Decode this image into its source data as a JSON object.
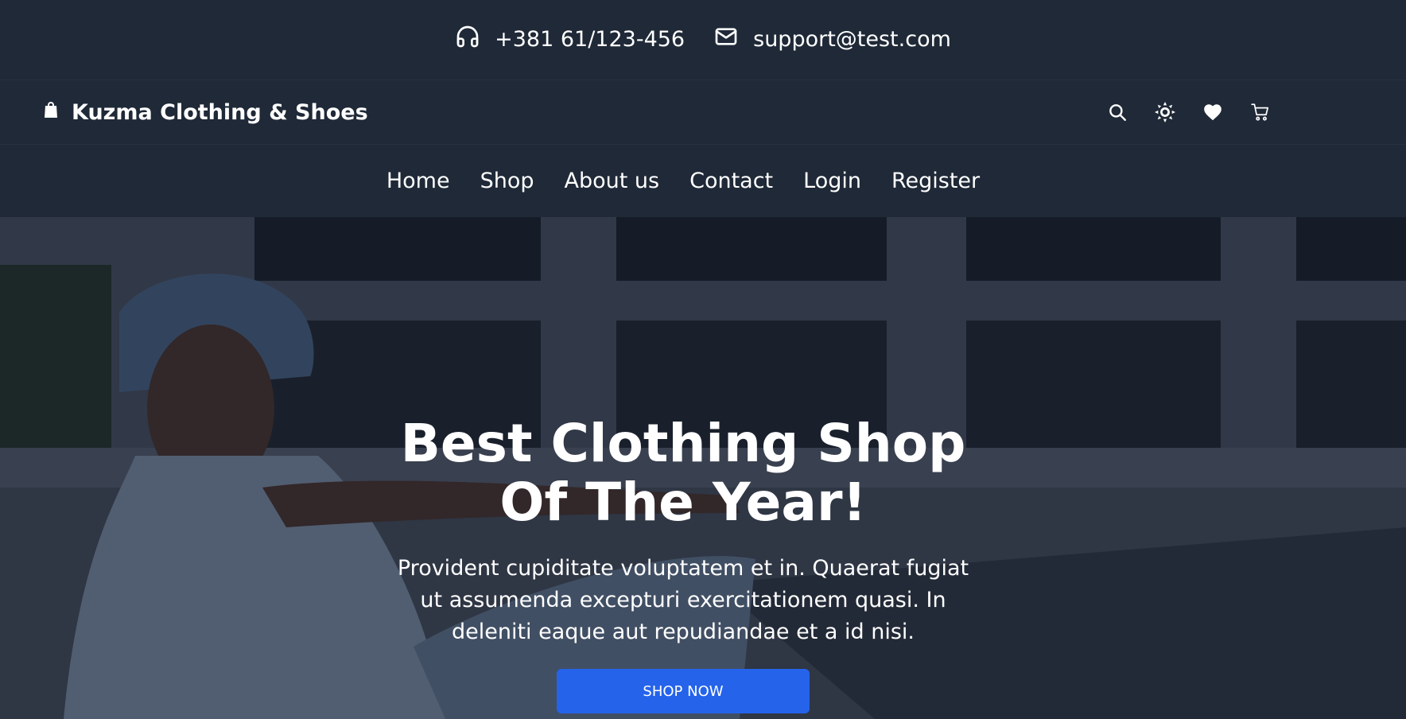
{
  "topbar": {
    "phone": "+381 61/123-456",
    "email": "support@test.com"
  },
  "header": {
    "brand": "Kuzma Clothing & Shoes"
  },
  "nav": {
    "items": [
      "Home",
      "Shop",
      "About us",
      "Contact",
      "Login",
      "Register"
    ]
  },
  "hero": {
    "title": "Best Clothing Shop Of The Year!",
    "text": "Provident cupiditate voluptatem et in. Quaerat fugiat ut assumenda excepturi exercitationem quasi. In deleniti eaque aut repudiandae et a id nisi.",
    "cta": "SHOP NOW"
  },
  "colors": {
    "background": "#1f2937",
    "accent": "#2563eb",
    "text": "#ffffff"
  },
  "icons": [
    "headphones-icon",
    "envelope-icon",
    "shopping-bag-icon",
    "search-icon",
    "sun-icon",
    "heart-icon",
    "cart-icon"
  ]
}
